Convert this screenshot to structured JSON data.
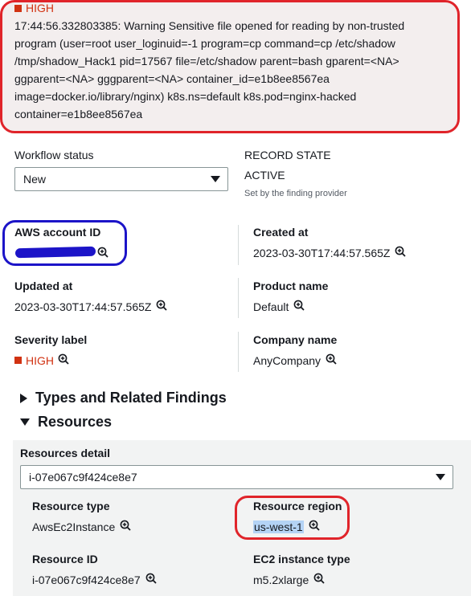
{
  "finding": {
    "severity": "HIGH",
    "lines": [
      "17:44:56.332803385: Warning Sensitive file opened for reading by non-trusted",
      "program (user=root user_loginuid=-1 program=cp command=cp /etc/shadow",
      "/tmp/shadow_Hack1 pid=17567 file=/etc/shadow parent=bash gparent=<NA>",
      "ggparent=<NA> gggparent=<NA> container_id=e1b8ee8567ea",
      "image=docker.io/library/nginx) k8s.ns=default k8s.pod=nginx-hacked",
      "container=e1b8ee8567ea"
    ]
  },
  "workflow": {
    "label": "Workflow status",
    "value": "New"
  },
  "record_state": {
    "label": "RECORD STATE",
    "value": "ACTIVE",
    "note": "Set by the finding provider"
  },
  "fields": {
    "aws_account_id": {
      "label": "AWS account ID"
    },
    "created_at": {
      "label": "Created at",
      "value": "2023-03-30T17:44:57.565Z"
    },
    "updated_at": {
      "label": "Updated at",
      "value": "2023-03-30T17:44:57.565Z"
    },
    "product_name": {
      "label": "Product name",
      "value": "Default"
    },
    "severity_label": {
      "label": "Severity label",
      "value": "HIGH"
    },
    "company_name": {
      "label": "Company name",
      "value": "AnyCompany"
    }
  },
  "sections": {
    "types": "Types and Related Findings",
    "resources": "Resources"
  },
  "resources": {
    "detail_label": "Resources detail",
    "selected": "i-07e067c9f424ce8e7",
    "resource_type": {
      "label": "Resource type",
      "value": "AwsEc2Instance"
    },
    "resource_region": {
      "label": "Resource region",
      "value": "us-west-1"
    },
    "resource_id": {
      "label": "Resource ID",
      "value": "i-07e067c9f424ce8e7"
    },
    "ec2_instance_type": {
      "label": "EC2 instance type",
      "value": "m5.2xlarge"
    }
  },
  "colors": {
    "severity_high": "#d13212",
    "annotation_red": "#e0242a",
    "annotation_blue": "#1c14c8",
    "selection_highlight": "#b4d3f5"
  },
  "icons": {
    "zoom": "magnifier-plus-icon",
    "severity": "red-square-icon",
    "dropdown": "caret-down-icon",
    "collapsed": "caret-right-icon",
    "expanded": "caret-down-icon"
  }
}
